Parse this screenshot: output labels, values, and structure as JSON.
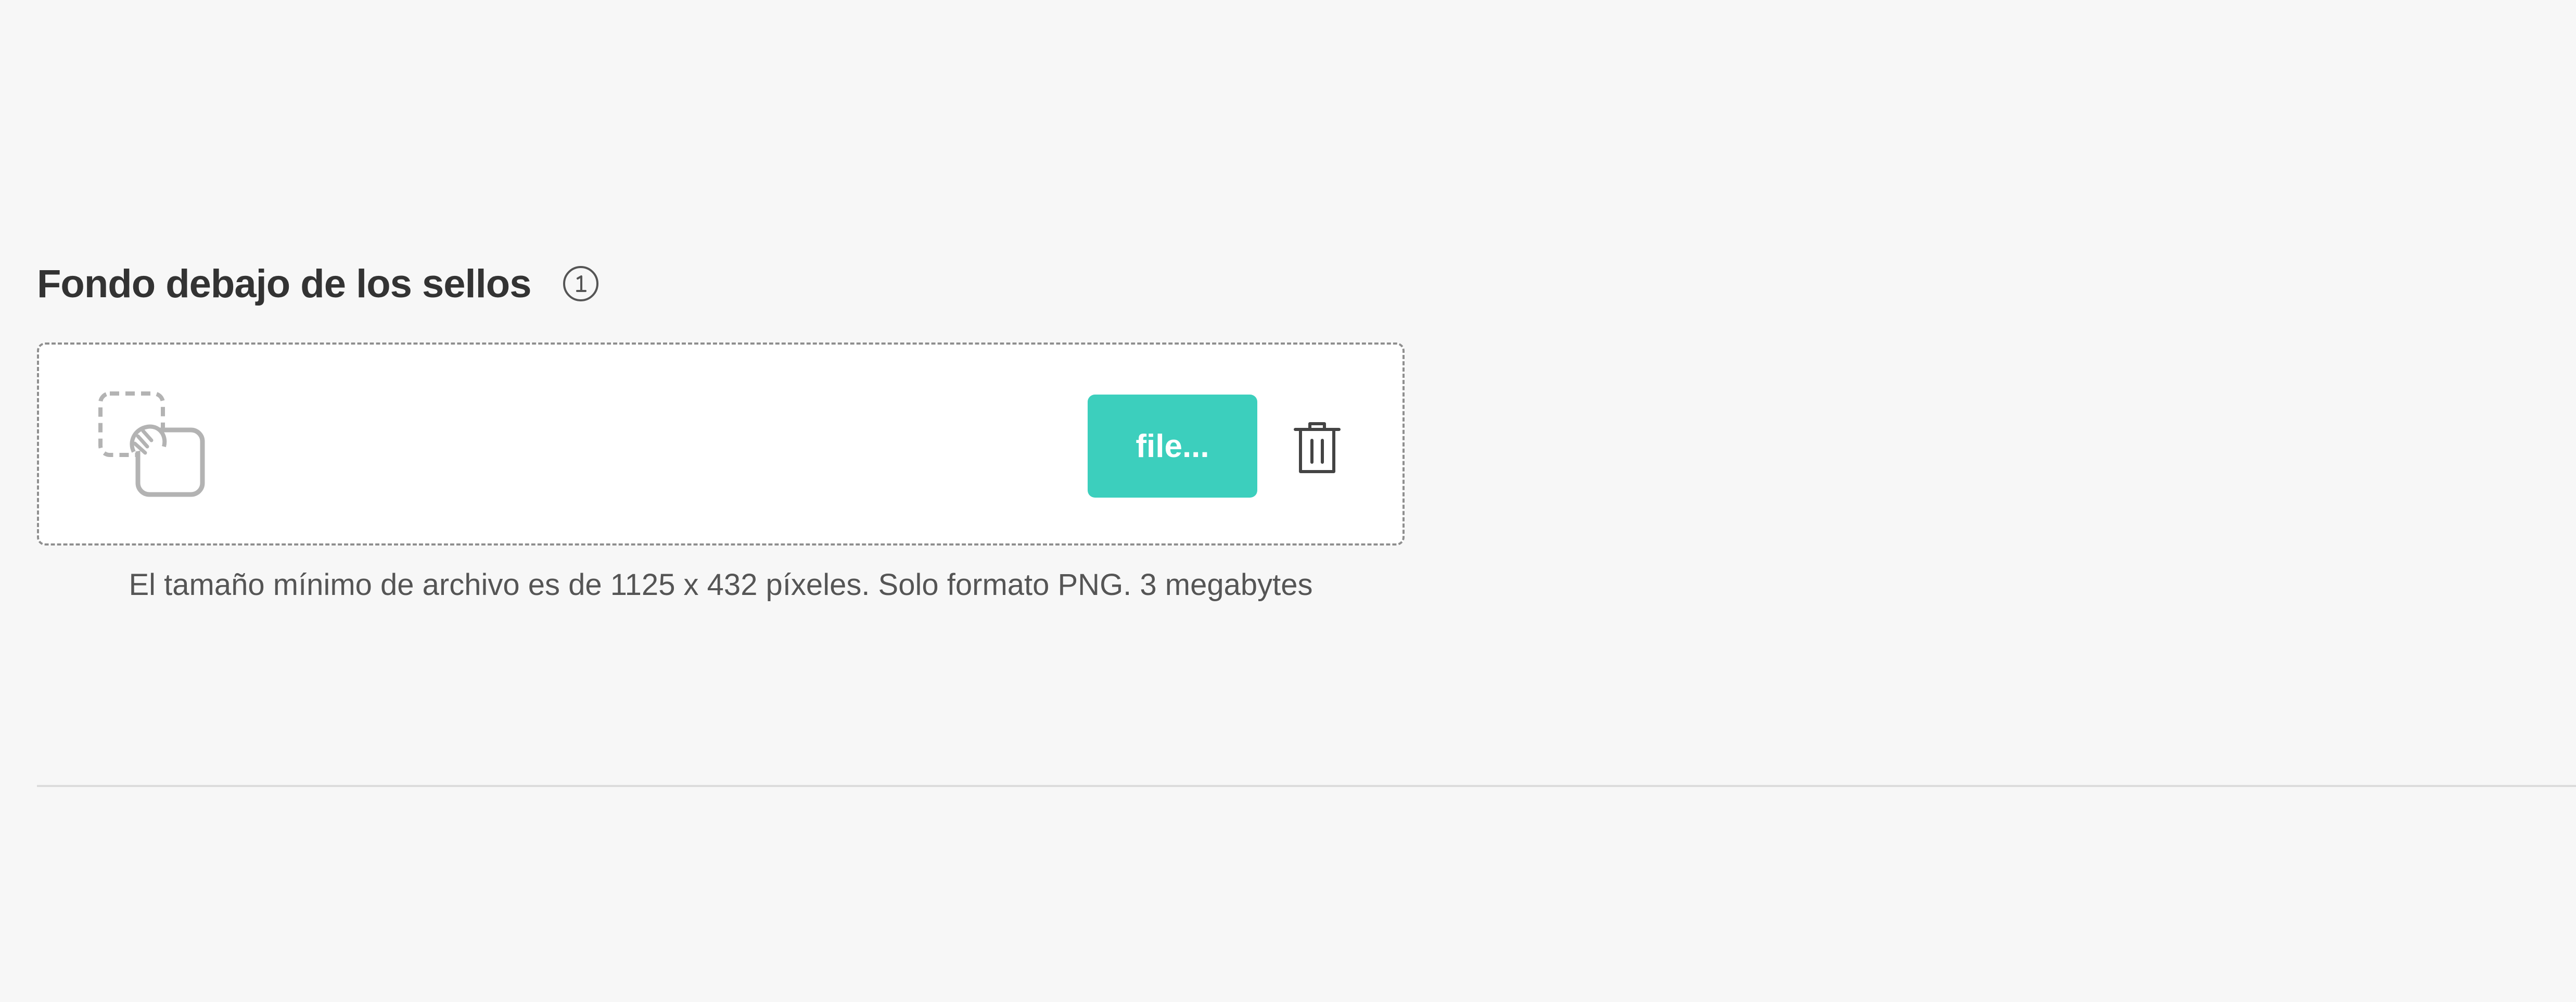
{
  "section": {
    "title": "Fondo debajo de los sellos",
    "info_icon": "info-circle-icon"
  },
  "upload": {
    "placeholder_icon": "image-placeholder-icon",
    "file_button_label": "file...",
    "delete_icon": "trash-icon",
    "hint": "El tamaño mínimo de archivo es de 1125 x 432 píxeles. Solo formato PNG. 3 megabytes"
  },
  "colors": {
    "accent": "#3ccfbd",
    "background": "#f7f7f7",
    "text": "#333333",
    "muted_text": "#555555",
    "border": "#8f8f8f"
  }
}
